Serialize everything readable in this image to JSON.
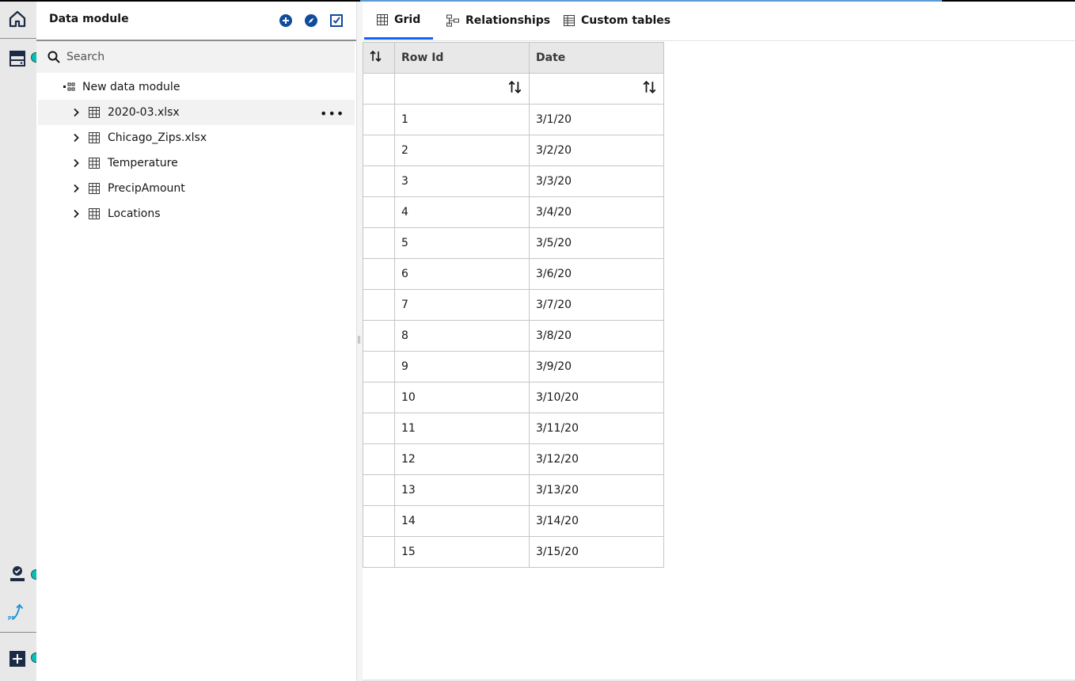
{
  "panel": {
    "title": "Data module",
    "search_placeholder": "Search",
    "root_label": "New data module",
    "items": [
      {
        "label": "2020-03.xlsx"
      },
      {
        "label": "Chicago_Zips.xlsx"
      },
      {
        "label": "Temperature"
      },
      {
        "label": "PrecipAmount"
      },
      {
        "label": "Locations"
      }
    ],
    "more_label": "•••"
  },
  "tabs": [
    {
      "label": "Grid"
    },
    {
      "label": "Relationships"
    },
    {
      "label": "Custom tables"
    }
  ],
  "grid": {
    "columns": [
      "Row Id",
      "Date"
    ],
    "rows": [
      [
        "1",
        "3/1/20"
      ],
      [
        "2",
        "3/2/20"
      ],
      [
        "3",
        "3/3/20"
      ],
      [
        "4",
        "3/4/20"
      ],
      [
        "5",
        "3/5/20"
      ],
      [
        "6",
        "3/6/20"
      ],
      [
        "7",
        "3/7/20"
      ],
      [
        "8",
        "3/8/20"
      ],
      [
        "9",
        "3/9/20"
      ],
      [
        "10",
        "3/10/20"
      ],
      [
        "11",
        "3/11/20"
      ],
      [
        "12",
        "3/12/20"
      ],
      [
        "13",
        "3/13/20"
      ],
      [
        "14",
        "3/14/20"
      ],
      [
        "15",
        "3/15/20"
      ]
    ]
  },
  "colors": {
    "accent": "#0f62fe",
    "status_dot": "#08bdba",
    "icon_blue": "#0f4c9c"
  }
}
